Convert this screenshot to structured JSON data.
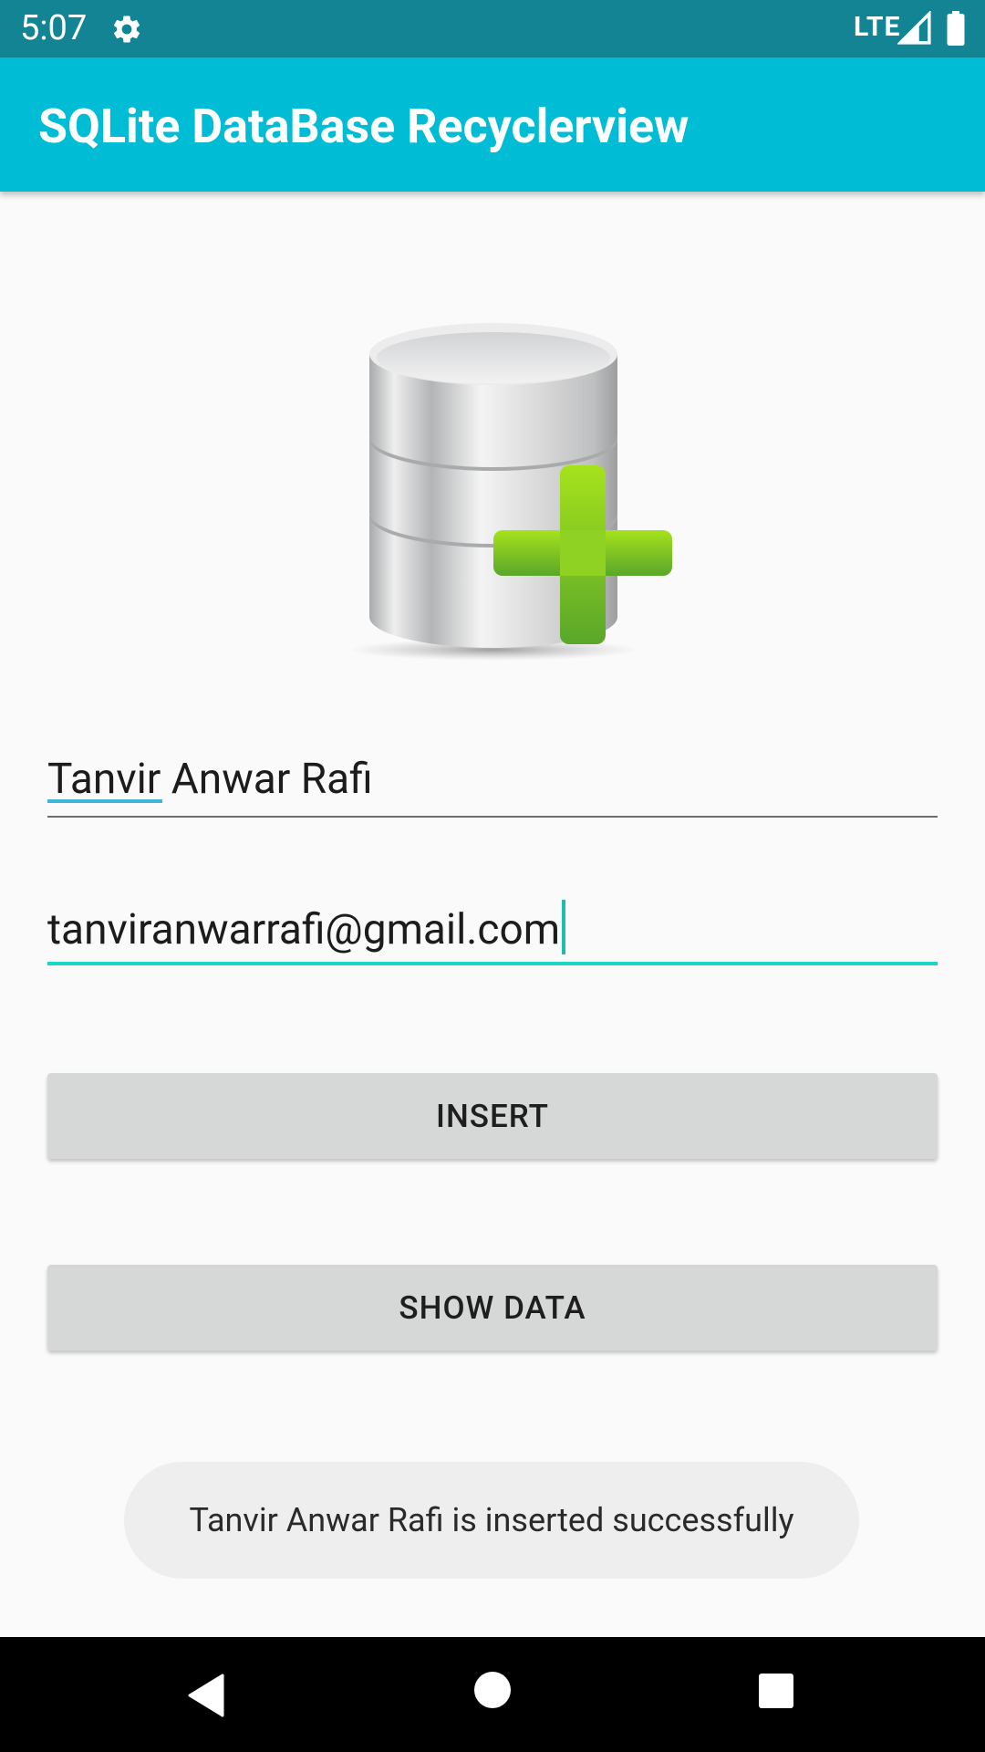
{
  "status_bar": {
    "time": "5:07",
    "network": "LTE"
  },
  "app_bar": {
    "title": "SQLite DataBase Recyclerview"
  },
  "form": {
    "name_value": "Tanvir Anwar Rafi",
    "email_value": "tanviranwarrafi@gmail.com"
  },
  "buttons": {
    "insert_label": "INSERT",
    "show_label": "SHOW DATA"
  },
  "toast": {
    "message": "Tanvir Anwar Rafi is inserted successfully"
  },
  "colors": {
    "status_bar": "#138494",
    "app_bar": "#00bcd4",
    "accent": "#1fd4c6",
    "button": "#d6d7d7"
  },
  "icons": {
    "status_settings": "gear-icon",
    "signal": "signal-icon",
    "battery": "battery-icon",
    "hero": "database-add-icon",
    "nav_back": "back-triangle-icon",
    "nav_home": "home-circle-icon",
    "nav_recent": "recents-square-icon"
  }
}
